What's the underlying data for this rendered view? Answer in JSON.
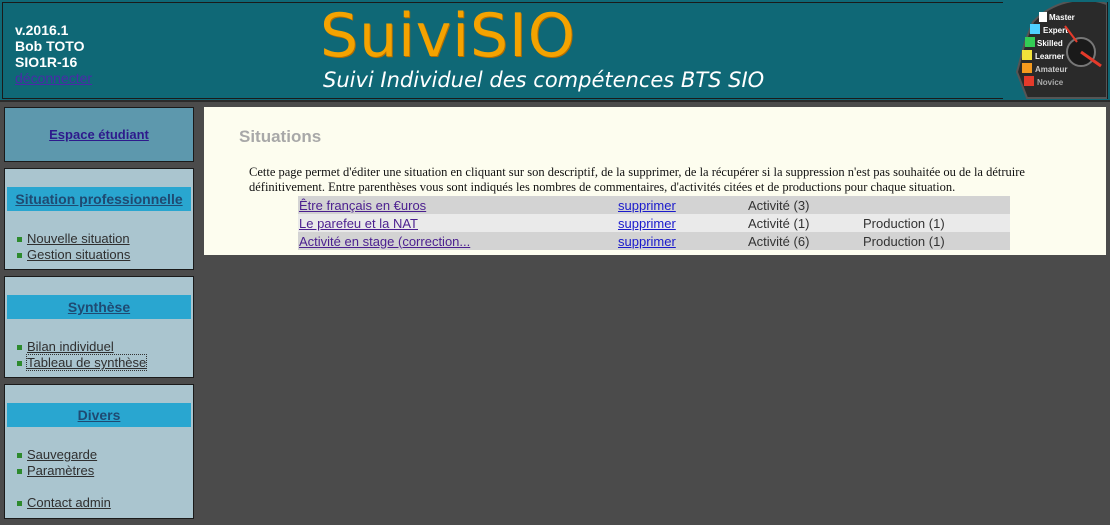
{
  "header": {
    "version": "v.2016.1",
    "user_name": "Bob TOTO",
    "class_code": "SIO1R-16",
    "logout_label": "déconnecter",
    "brand": "SuiviSIO",
    "tagline": "Suivi Individuel des compétences BTS SIO",
    "gauge_levels": [
      "Master",
      "Expert",
      "Skilled",
      "Learner",
      "Amateur",
      "Novice"
    ],
    "colors": {
      "header_bg": "#0f6876",
      "brand": "#f4a300"
    }
  },
  "sidebar": {
    "student_space": "Espace étudiant",
    "sections": [
      {
        "title": "Situation professionnelle",
        "items": [
          {
            "label": "Nouvelle situation"
          },
          {
            "label": "Gestion situations"
          }
        ]
      },
      {
        "title": "Synthèse",
        "items": [
          {
            "label": "Bilan individuel"
          },
          {
            "label": "Tableau de synthèse"
          }
        ]
      },
      {
        "title": "Divers",
        "items": [
          {
            "label": "Sauvegarde"
          },
          {
            "label": "Paramètres"
          },
          {
            "label": "Contact admin"
          }
        ]
      }
    ]
  },
  "main": {
    "title": "Situations",
    "intro": "Cette page permet d'éditer une situation en cliquant sur son descriptif, de la supprimer, de la récupérer si la suppression n'est pas souhaitée ou de la détruire définitivement. Entre parenthèses vous sont indiqués les nombres de commentaires, d'activités citées et de productions pour chaque situation.",
    "situations": [
      {
        "title": "Être français en €uros",
        "delete_label": "supprimer",
        "activities": "Activité (3)",
        "productions": ""
      },
      {
        "title": "Le parefeu et la NAT",
        "delete_label": "supprimer",
        "activities": "Activité (1)",
        "productions": "Production (1)"
      },
      {
        "title": "Activité en stage (correction...",
        "delete_label": "supprimer",
        "activities": "Activité (6)",
        "productions": "Production (1)"
      }
    ]
  }
}
